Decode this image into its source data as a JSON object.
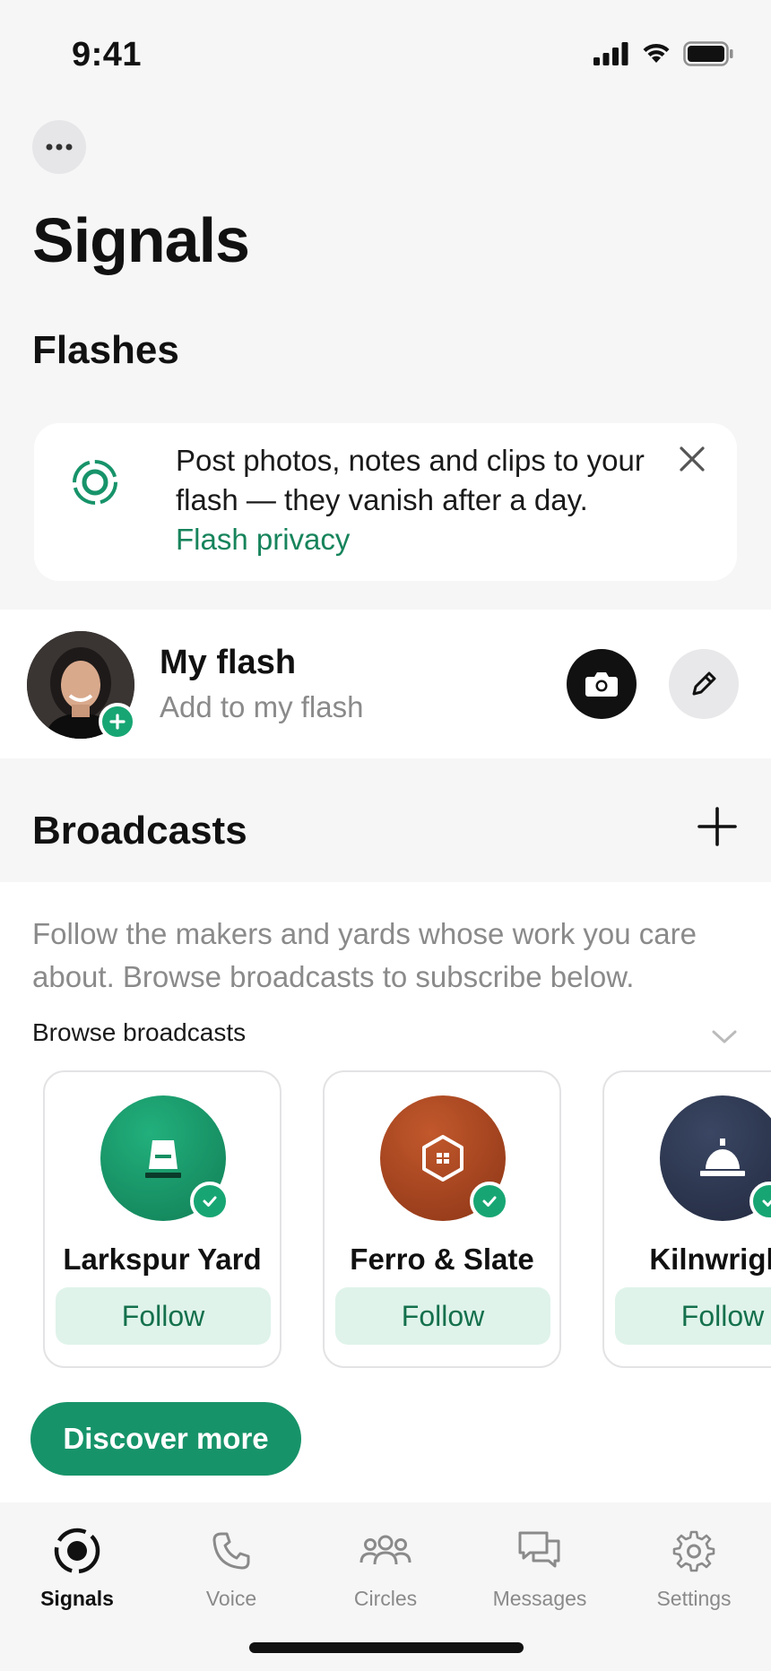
{
  "status_bar": {
    "time": "9:41"
  },
  "header": {
    "title": "Signals"
  },
  "flashes": {
    "section_title": "Flashes",
    "notice": {
      "text": "Post photos, notes and clips to your flash — they vanish after a day.",
      "link_label": "Flash privacy"
    },
    "my_flash": {
      "title": "My flash",
      "subtitle": "Add to my flash"
    }
  },
  "broadcasts": {
    "section_title": "Broadcasts",
    "description": "Follow the makers and yards whose work you care about. Browse broadcasts to subscribe below.",
    "browse_label": "Browse broadcasts",
    "cards": [
      {
        "name": "Larkspur Yard",
        "follow_label": "Follow",
        "color": "#168f63",
        "icon": "bucket-icon"
      },
      {
        "name": "Ferro & Slate",
        "follow_label": "Follow",
        "color": "#a8461f",
        "icon": "hexagon-window-icon"
      },
      {
        "name": "Kilnwright",
        "follow_label": "Follow",
        "color": "#2c3650",
        "icon": "bell-icon"
      }
    ],
    "discover_label": "Discover more"
  },
  "tabs": [
    {
      "label": "Signals",
      "icon": "signals-icon",
      "active": true
    },
    {
      "label": "Voice",
      "icon": "phone-icon",
      "active": false
    },
    {
      "label": "Circles",
      "icon": "group-icon",
      "active": false
    },
    {
      "label": "Messages",
      "icon": "chat-bubbles-icon",
      "active": false
    },
    {
      "label": "Settings",
      "icon": "gear-icon",
      "active": false
    }
  ],
  "colors": {
    "accent": "#17936a",
    "accent_light": "#dff3ea",
    "accent_text": "#14704d"
  }
}
